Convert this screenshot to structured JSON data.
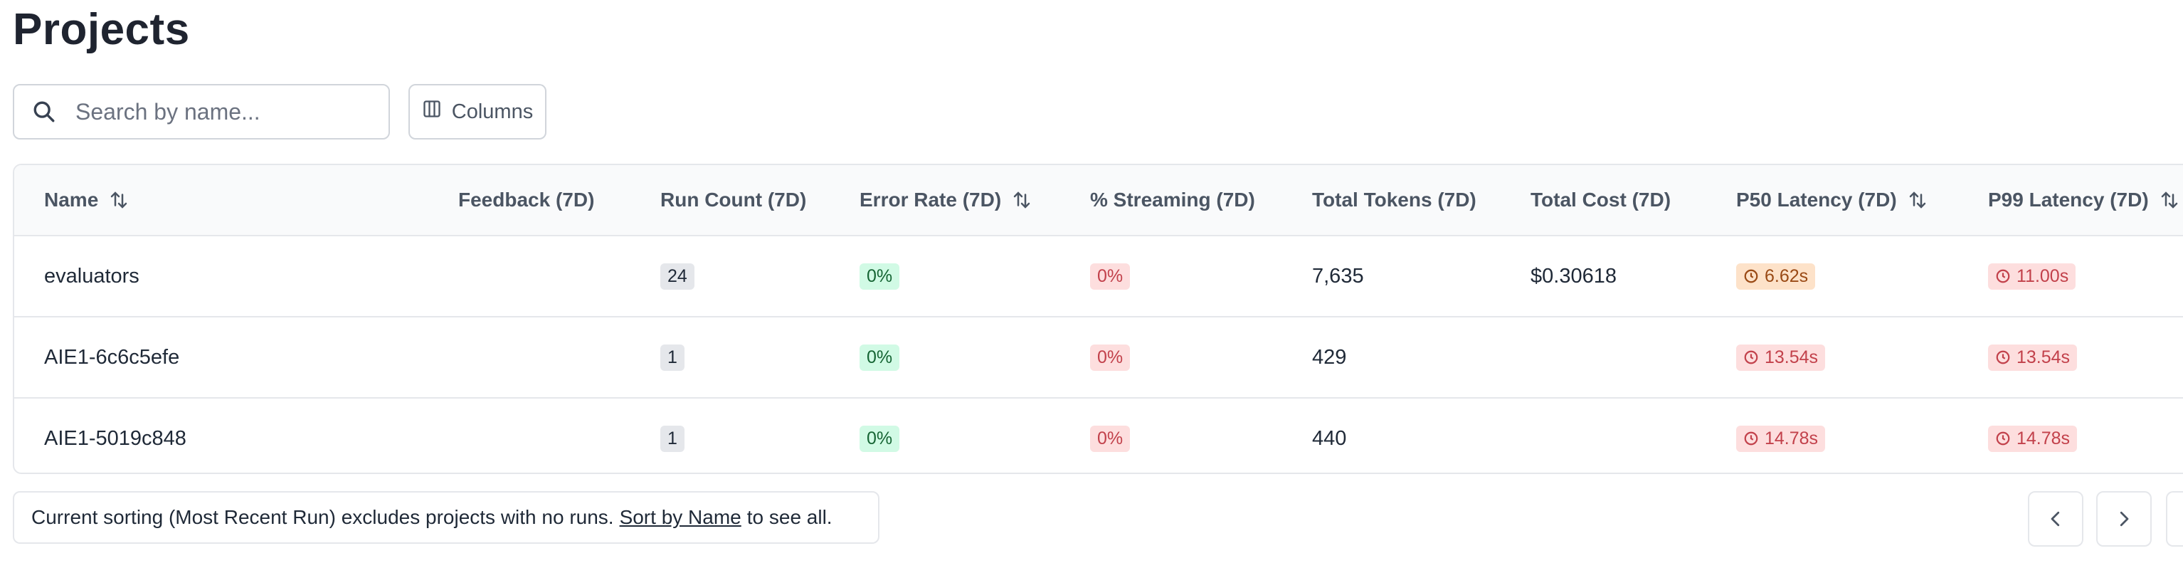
{
  "page": {
    "title": "Projects"
  },
  "search": {
    "placeholder": "Search by name..."
  },
  "toolbar": {
    "columns_label": "Columns"
  },
  "table": {
    "headers": {
      "name": "Name",
      "feedback": "Feedback (7D)",
      "run_count": "Run Count (7D)",
      "error_rate": "Error Rate (7D)",
      "streaming": "% Streaming (7D)",
      "total_tokens": "Total Tokens (7D)",
      "total_cost": "Total Cost (7D)",
      "p50": "P50 Latency (7D)",
      "p99": "P99 Latency (7D)"
    },
    "rows": [
      {
        "name": "evaluators",
        "feedback": "",
        "run_count": "24",
        "error_rate": "0%",
        "streaming": "0%",
        "total_tokens": "7,635",
        "total_cost": "$0.30618",
        "p50": "6.62s",
        "p99": "11.00s"
      },
      {
        "name": "AIE1-6c6c5efe",
        "feedback": "",
        "run_count": "1",
        "error_rate": "0%",
        "streaming": "0%",
        "total_tokens": "429",
        "total_cost": "",
        "p50": "13.54s",
        "p99": "13.54s"
      },
      {
        "name": "AIE1-5019c848",
        "feedback": "",
        "run_count": "1",
        "error_rate": "0%",
        "streaming": "0%",
        "total_tokens": "440",
        "total_cost": "",
        "p50": "14.78s",
        "p99": "14.78s"
      }
    ]
  },
  "footer": {
    "note_before": "Current sorting (Most Recent Run) excludes projects with no runs.",
    "note_link": "Sort by Name",
    "note_after": "to see all."
  },
  "colors": {
    "badge_green": "#d1fae5",
    "badge_red": "#fddede",
    "badge_orange": "#fde2c9",
    "badge_gray": "#e5e7eb"
  }
}
